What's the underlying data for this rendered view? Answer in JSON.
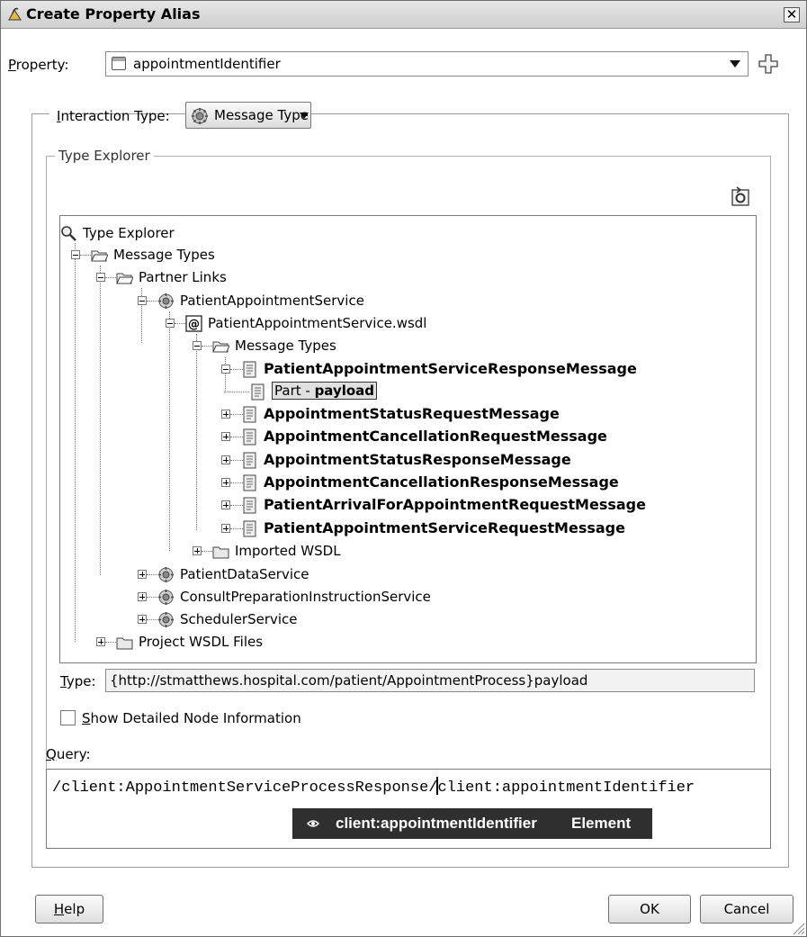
{
  "window": {
    "title": "Create Property Alias"
  },
  "property": {
    "label_key": "P",
    "label_rest": "roperty:",
    "value": "appointmentIdentifier"
  },
  "interaction": {
    "label_key": "I",
    "label_rest": "nteraction Type:",
    "value": "Message Type"
  },
  "type_explorer": {
    "group_title": "Type Explorer",
    "tree": [
      {
        "label": "Type Explorer",
        "icon": "search-icon",
        "bold": false
      },
      {
        "label": "Message Types",
        "icon": "folder-open-icon",
        "bold": false
      },
      {
        "label": "Partner Links",
        "icon": "folder-open-icon",
        "bold": false
      },
      {
        "label": "PatientAppointmentService",
        "icon": "service-gear-icon",
        "bold": false
      },
      {
        "label": "PatientAppointmentService.wsdl",
        "icon": "wsdl-at-icon",
        "bold": false
      },
      {
        "label": "Message Types",
        "icon": "folder-open-icon",
        "bold": false
      },
      {
        "label": "PatientAppointmentServiceResponseMessage",
        "icon": "message-icon",
        "bold": true
      },
      {
        "label_prefix": "Part - ",
        "label_bold": "payload",
        "icon": "message-icon",
        "selected": true
      },
      {
        "label": "AppointmentStatusRequestMessage",
        "icon": "message-icon",
        "bold": true
      },
      {
        "label": "AppointmentCancellationRequestMessage",
        "icon": "message-icon",
        "bold": true
      },
      {
        "label": "AppointmentStatusResponseMessage",
        "icon": "message-icon",
        "bold": true
      },
      {
        "label": "AppointmentCancellationResponseMessage",
        "icon": "message-icon",
        "bold": true
      },
      {
        "label": "PatientArrivalForAppointmentRequestMessage",
        "icon": "message-icon",
        "bold": true
      },
      {
        "label": "PatientAppointmentServiceRequestMessage",
        "icon": "message-icon",
        "bold": true
      },
      {
        "label": "Imported WSDL",
        "icon": "folder-closed-icon",
        "bold": false
      },
      {
        "label": "PatientDataService",
        "icon": "service-gear-icon",
        "bold": false
      },
      {
        "label": "ConsultPreparationInstructionService",
        "icon": "service-gear-icon",
        "bold": false
      },
      {
        "label": "SchedulerService",
        "icon": "service-gear-icon",
        "bold": false
      },
      {
        "label": "Project WSDL Files",
        "icon": "folder-closed-icon",
        "bold": false
      }
    ],
    "type_label_key": "T",
    "type_label_rest": "ype:",
    "type_value": "{http://stmatthews.hospital.com/patient/AppointmentProcess}payload",
    "show_detail_key": "S",
    "show_detail_rest": "how Detailed Node Information",
    "show_detail_checked": false
  },
  "query": {
    "label_key": "Q",
    "label_rest": "uery:",
    "before_caret": "/client:AppointmentServiceProcessResponse/",
    "after_caret": "client:appointmentIdentifier",
    "suggestion_name": "client:appointmentIdentifier",
    "suggestion_kind": "Element"
  },
  "buttons": {
    "help_key": "H",
    "help_rest": "elp",
    "ok": "OK",
    "cancel": "Cancel"
  }
}
